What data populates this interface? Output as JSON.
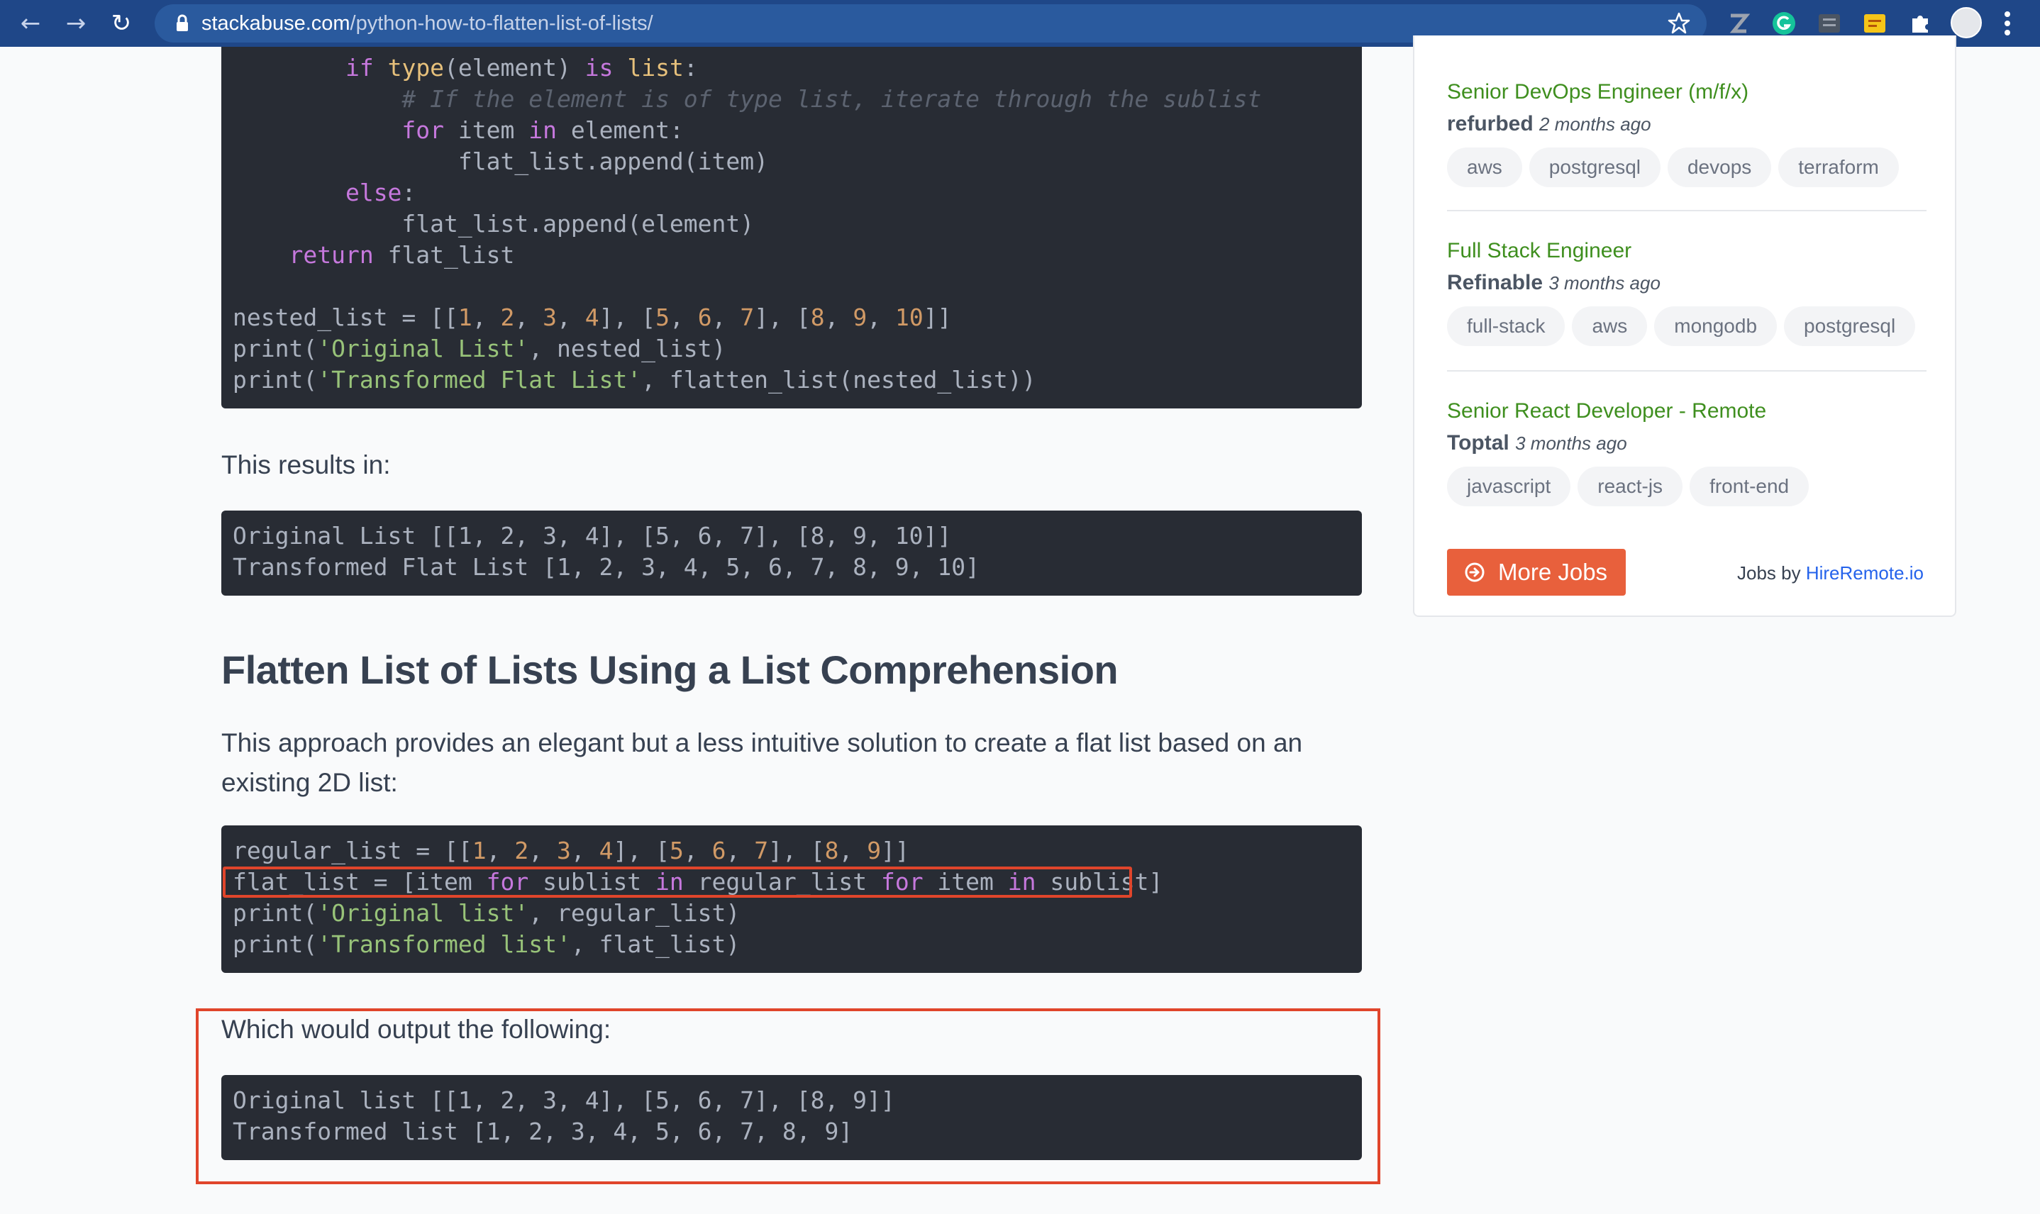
{
  "browser": {
    "url_domain": "stackabuse.com",
    "url_path": "/python-how-to-flatten-list-of-lists/",
    "back_glyph": "←",
    "forward_glyph": "→",
    "reload_glyph": "↻",
    "extensions": [
      {
        "name": "zotero-extension-icon",
        "color": "#9ca3af"
      },
      {
        "name": "grammarly-extension-icon",
        "color": "#15c39a"
      },
      {
        "name": "gitzip-extension-icon",
        "color": "#6b7280"
      },
      {
        "name": "notes-extension-icon",
        "color": "#f5c518"
      },
      {
        "name": "puzzle-extensions-icon",
        "color": "#ffffff"
      }
    ]
  },
  "code_blocks": {
    "flatten_function": [
      [
        {
          "t": "        "
        },
        {
          "t": "if",
          "c": "kw"
        },
        {
          "t": " "
        },
        {
          "t": "type",
          "c": "bi"
        },
        {
          "t": "(element) "
        },
        {
          "t": "is",
          "c": "kw"
        },
        {
          "t": " "
        },
        {
          "t": "list",
          "c": "bi"
        },
        {
          "t": ":"
        }
      ],
      [
        {
          "t": "            "
        },
        {
          "t": "# If the element is of type list, iterate through the sublist",
          "c": "cm"
        }
      ],
      [
        {
          "t": "            "
        },
        {
          "t": "for",
          "c": "kw"
        },
        {
          "t": " item "
        },
        {
          "t": "in",
          "c": "kw"
        },
        {
          "t": " element:"
        }
      ],
      [
        {
          "t": "                flat_list.append(item)"
        }
      ],
      [
        {
          "t": "        "
        },
        {
          "t": "else",
          "c": "kw"
        },
        {
          "t": ":"
        }
      ],
      [
        {
          "t": "            flat_list.append(element)"
        }
      ],
      [
        {
          "t": "    "
        },
        {
          "t": "return",
          "c": "kw"
        },
        {
          "t": " flat_list"
        }
      ],
      [
        {
          "t": ""
        }
      ],
      [
        {
          "t": "nested_list = [["
        },
        {
          "t": "1",
          "c": "num"
        },
        {
          "t": ", "
        },
        {
          "t": "2",
          "c": "num"
        },
        {
          "t": ", "
        },
        {
          "t": "3",
          "c": "num"
        },
        {
          "t": ", "
        },
        {
          "t": "4",
          "c": "num"
        },
        {
          "t": "], ["
        },
        {
          "t": "5",
          "c": "num"
        },
        {
          "t": ", "
        },
        {
          "t": "6",
          "c": "num"
        },
        {
          "t": ", "
        },
        {
          "t": "7",
          "c": "num"
        },
        {
          "t": "], ["
        },
        {
          "t": "8",
          "c": "num"
        },
        {
          "t": ", "
        },
        {
          "t": "9",
          "c": "num"
        },
        {
          "t": ", "
        },
        {
          "t": "10",
          "c": "num"
        },
        {
          "t": "]]"
        }
      ],
      [
        {
          "t": "print("
        },
        {
          "t": "'Original List'",
          "c": "str"
        },
        {
          "t": ", nested_list)"
        }
      ],
      [
        {
          "t": "print("
        },
        {
          "t": "'Transformed Flat List'",
          "c": "str"
        },
        {
          "t": ", flatten_list(nested_list))"
        }
      ]
    ],
    "output_1": [
      [
        {
          "t": "Original List [[1, 2, 3, 4], [5, 6, 7], [8, 9, 10]]"
        }
      ],
      [
        {
          "t": "Transformed Flat List [1, 2, 3, 4, 5, 6, 7, 8, 9, 10]"
        }
      ]
    ],
    "comprehension": [
      [
        {
          "t": "regular_list = [["
        },
        {
          "t": "1",
          "c": "num"
        },
        {
          "t": ", "
        },
        {
          "t": "2",
          "c": "num"
        },
        {
          "t": ", "
        },
        {
          "t": "3",
          "c": "num"
        },
        {
          "t": ", "
        },
        {
          "t": "4",
          "c": "num"
        },
        {
          "t": "], ["
        },
        {
          "t": "5",
          "c": "num"
        },
        {
          "t": ", "
        },
        {
          "t": "6",
          "c": "num"
        },
        {
          "t": ", "
        },
        {
          "t": "7",
          "c": "num"
        },
        {
          "t": "], ["
        },
        {
          "t": "8",
          "c": "num"
        },
        {
          "t": ", "
        },
        {
          "t": "9",
          "c": "num"
        },
        {
          "t": "]]"
        }
      ],
      [
        {
          "t": "flat_list = [item "
        },
        {
          "t": "for",
          "c": "kw"
        },
        {
          "t": " sublist "
        },
        {
          "t": "in",
          "c": "kw"
        },
        {
          "t": " regular_list "
        },
        {
          "t": "for",
          "c": "kw"
        },
        {
          "t": " item "
        },
        {
          "t": "in",
          "c": "kw"
        },
        {
          "t": " sublist]"
        }
      ],
      [
        {
          "t": "print("
        },
        {
          "t": "'Original list'",
          "c": "str"
        },
        {
          "t": ", regular_list)"
        }
      ],
      [
        {
          "t": "print("
        },
        {
          "t": "'Transformed list'",
          "c": "str"
        },
        {
          "t": ", flat_list)"
        }
      ]
    ],
    "output_2": [
      [
        {
          "t": "Original list [[1, 2, 3, 4], [5, 6, 7], [8, 9]]"
        }
      ],
      [
        {
          "t": "Transformed list [1, 2, 3, 4, 5, 6, 7, 8, 9]"
        }
      ]
    ]
  },
  "article": {
    "results_text": "This results in:",
    "heading": "Flatten List of Lists Using a List Comprehension",
    "intro_line1": "This approach provides an elegant but a less intuitive solution to create a flat list based on an",
    "intro_line2": "existing 2D list:",
    "output_text": "Which would output the following:"
  },
  "sidebar": {
    "jobs": [
      {
        "title": "Senior DevOps Engineer (m/f/x)",
        "company": "refurbed",
        "time": "2 months ago",
        "tags": [
          "aws",
          "postgresql",
          "devops",
          "terraform"
        ]
      },
      {
        "title": "Full Stack Engineer",
        "company": "Refinable",
        "time": "3 months ago",
        "tags": [
          "full-stack",
          "aws",
          "mongodb",
          "postgresql"
        ]
      },
      {
        "title": "Senior React Developer - Remote",
        "company": "Toptal",
        "time": "3 months ago",
        "tags": [
          "javascript",
          "react-js",
          "front-end"
        ]
      }
    ],
    "more_jobs_label": "More Jobs",
    "jobs_by_prefix": "Jobs by",
    "jobs_by_link": "HireRemote.io"
  }
}
